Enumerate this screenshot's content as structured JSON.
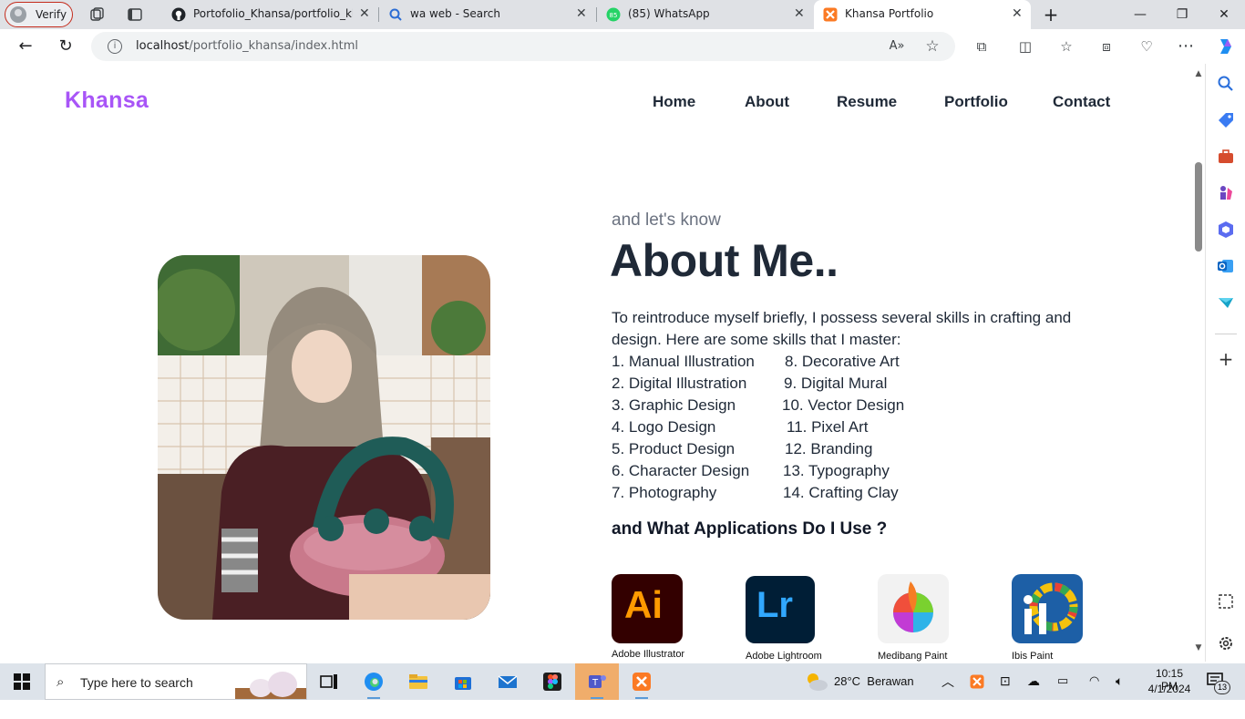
{
  "browser": {
    "profile_label": "Verify",
    "tabs": [
      {
        "title": "Portofolio_Khansa/portfolio_khan",
        "icon": "github-icon"
      },
      {
        "title": "wa web - Search",
        "icon": "bing-search-icon"
      },
      {
        "title": "(85) WhatsApp",
        "icon": "whatsapp-icon"
      },
      {
        "title": "Khansa Portfolio",
        "icon": "xampp-icon",
        "active": true
      }
    ],
    "url_host": "localhost",
    "url_path": "/portfolio_khansa/index.html",
    "colors": {
      "strip": "#dfe1e5",
      "active_tab": "#ffffff"
    }
  },
  "site": {
    "brand": "Khansa",
    "nav": [
      "Home",
      "About",
      "Resume",
      "Portfolio",
      "Contact"
    ],
    "kicker": "and let's know",
    "title": "About Me..",
    "intro": "To reintroduce myself briefly, I possess several skills in crafting and design. Here are some skills that I master:",
    "skills_left": [
      "1. Manual Illustration",
      "2. Digital Illustration",
      "3. Graphic Design",
      "4. Logo Design",
      "5. Product Design",
      "6. Character Design",
      "7. Photography"
    ],
    "skills_right": [
      "8. Decorative Art",
      "9. Digital Mural",
      "10. Vector Design",
      "11. Pixel Art",
      "12. Branding",
      "13. Typography",
      "14. Crafting Clay"
    ],
    "apps_heading": "and What Applications Do I Use ?",
    "apps": [
      {
        "name": "Adobe Illustrator",
        "logo_text": "Ai"
      },
      {
        "name": "Adobe Lightroom",
        "logo_text": "Lr"
      },
      {
        "name": "Medibang Paint",
        "logo_text": ""
      },
      {
        "name": "Ibis Paint",
        "logo_text": ""
      }
    ],
    "colors": {
      "brand": "#a855f7",
      "heading": "#1f2937",
      "muted": "#6b7280"
    }
  },
  "taskbar": {
    "search_placeholder": "Type here to search",
    "weather": "28°C  Berawan",
    "time": "10:15 PM",
    "date": "4/1/2024",
    "notifications": "13"
  }
}
